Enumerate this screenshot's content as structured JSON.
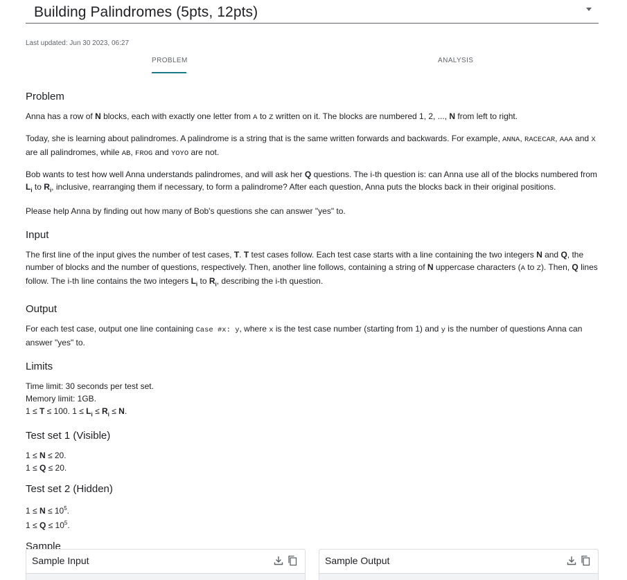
{
  "header": {
    "title": "Building Palindromes (5pts, 12pts)"
  },
  "meta": {
    "last_updated": "Last updated: Jun 30 2023, 06:27"
  },
  "tabs": [
    {
      "label": "PROBLEM"
    },
    {
      "label": "ANALYSIS"
    }
  ],
  "sections": {
    "problem_heading": "Problem",
    "p1": {
      "a": "Anna has a row of ",
      "b": "N",
      "c": " blocks, each with exactly one letter from ",
      "d": "A",
      "e": " to ",
      "f": "Z",
      "g": " written on it. The blocks are numbered 1, 2, ..., ",
      "h": "N",
      "i": " from left to right."
    },
    "p2": {
      "a": "Today, she is learning about palindromes. A palindrome is a string that is the same written forwards and backwards. For example, ",
      "b": "ANNA",
      "c": ", ",
      "d": "RACECAR",
      "e": ", ",
      "f": "AAA",
      "g": " and ",
      "h": "X",
      "i": " are all palindromes, while ",
      "j": "AB",
      "k": ", ",
      "l": "FROG",
      "m": " and ",
      "n": "YOYO",
      "o": " are not."
    },
    "p3": {
      "a": "Bob wants to test how well Anna understands palindromes, and will ask her ",
      "b": "Q",
      "c": " questions. The i-th question is: can Anna use all of the blocks numbered from ",
      "d": "L",
      "d_sub": "i",
      "e": " to ",
      "f": "R",
      "f_sub": "i",
      "g": ", inclusive, rearranging them if necessary, to form a palindrome? After each question, Anna puts the blocks back in their original positions."
    },
    "p4": "Please help Anna by finding out how many of Bob's questions she can answer \"yes\" to.",
    "input_heading": "Input",
    "p5": {
      "a": "The first line of the input gives the number of test cases, ",
      "b": "T",
      "c": ". ",
      "d": "T",
      "e": " test cases follow. Each test case starts with a line containing the two integers ",
      "f": "N",
      "g": " and ",
      "h": "Q",
      "i": ", the number of blocks and the number of questions, respectively. Then, another line follows, containing a string of ",
      "j": "N",
      "k": " uppercase characters (",
      "l": "A",
      "m": " to ",
      "n": "Z",
      "o": "). Then, ",
      "p": "Q",
      "q": " lines follow. The i-th line contains the two integers ",
      "r": "L",
      "r_sub": "i",
      "s": " to ",
      "t": "R",
      "t_sub": "i",
      "u": ", describing the i-th question."
    },
    "output_heading": "Output",
    "p6": {
      "a": "For each test case, output one line containing ",
      "b": "Case #x: y",
      "c": ", where ",
      "d": "x",
      "e": " is the test case number (starting from 1) and ",
      "f": "y",
      "g": " is the number of questions Anna can answer \"yes\" to."
    },
    "limits_heading": "Limits",
    "limits": {
      "time": "Time limit: 30 seconds per test set.",
      "memory": "Memory limit: 1GB.",
      "l3a": "1 ≤ ",
      "l3b": "T",
      "l3c": " ≤ 100. 1 ≤ ",
      "l3d": "L",
      "l3d_sub": "i",
      "l3e": " ≤ ",
      "l3f": "R",
      "l3f_sub": "i",
      "l3g": " ≤ ",
      "l3h": "N",
      "l3i": "."
    },
    "ts1_heading": "Test set 1 (Visible)",
    "ts1": {
      "a1": "1 ≤ ",
      "b1": "N",
      "c1": " ≤ 20.",
      "a2": "1 ≤ ",
      "b2": "Q",
      "c2": " ≤ 20."
    },
    "ts2_heading": "Test set 2 (Hidden)",
    "ts2": {
      "a1": "1 ≤ ",
      "b1": "N",
      "c1": " ≤ 10",
      "s1": "5",
      "d1": ".",
      "a2": "1 ≤ ",
      "b2": "Q",
      "c2": " ≤ 10",
      "s2": "5",
      "d2": "."
    },
    "sample_heading": "Sample"
  },
  "samples": {
    "input_title": "Sample Input",
    "output_title": "Sample Output",
    "download_icon": "download-icon",
    "copy_icon": "copy-icon"
  },
  "colors": {
    "accent": "#1b7a8c",
    "text": "#202124",
    "muted": "#5f6368"
  }
}
